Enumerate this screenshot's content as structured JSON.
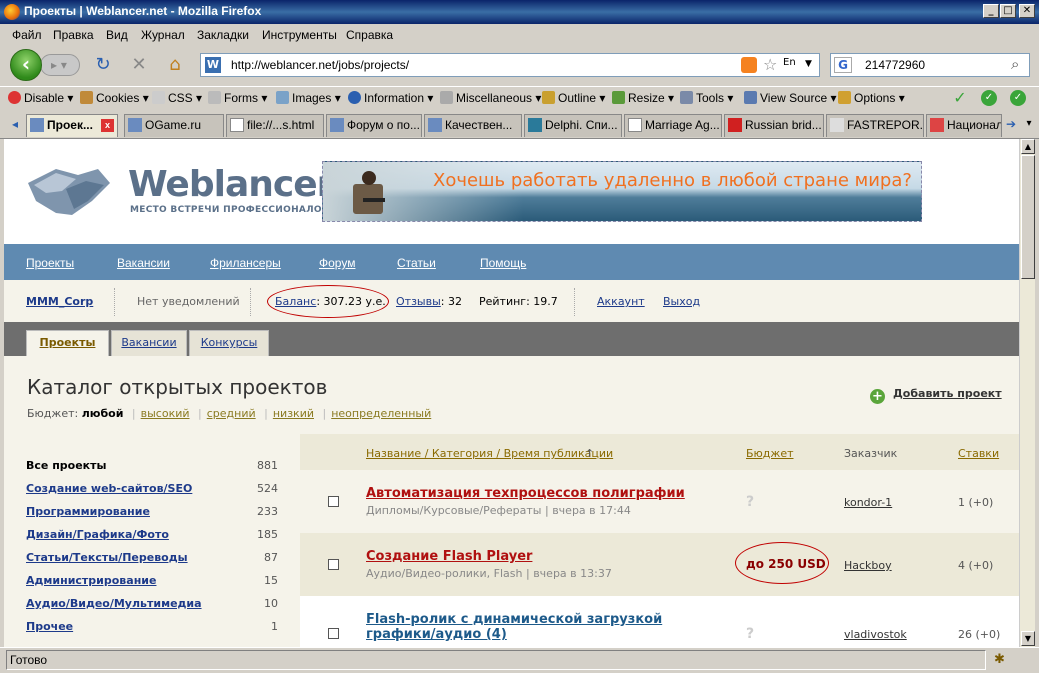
{
  "window": {
    "title": "Проекты | Weblancer.net - Mozilla Firefox",
    "buttons": [
      "_",
      "□",
      "✕"
    ]
  },
  "menu": [
    "Файл",
    "Правка",
    "Вид",
    "Журнал",
    "Закладки",
    "Инструменты",
    "Справка"
  ],
  "nav": {
    "url": "http://weblancer.net/jobs/projects/",
    "search_value": "214772960",
    "favicon_letter": "W",
    "search_engine_letter": "G",
    "lang_label": "En"
  },
  "devtoolbar": [
    "Disable",
    "Cookies",
    "CSS",
    "Forms",
    "Images",
    "Information",
    "Miscellaneous",
    "Outline",
    "Resize",
    "Tools",
    "View Source",
    "Options"
  ],
  "tabs": [
    {
      "label": "Проек...",
      "active": true
    },
    {
      "label": "OGame.ru"
    },
    {
      "label": "file://...s.html"
    },
    {
      "label": "Форум о по..."
    },
    {
      "label": "Качествен..."
    },
    {
      "label": "Delphi. Спи..."
    },
    {
      "label": "Marriage Ag..."
    },
    {
      "label": "Russian brid..."
    },
    {
      "label": "FASTREPOR..."
    },
    {
      "label": "Национал"
    }
  ],
  "site": {
    "logo": "Weblancer",
    "logo_sub": "МЕСТО ВСТРЕЧИ ПРОФЕССИОНАЛОВ",
    "banner_text": "Хочешь работать удаленно в любой стране мира?",
    "nav": [
      "Проекты",
      "Вакансии",
      "Фрилансеры",
      "Форум",
      "Статьи",
      "Помощь"
    ],
    "user": {
      "name": "MMM_Corp",
      "notifications": "Нет уведомлений",
      "balance_label": "Баланс",
      "balance_value": ": 307.23 у.е.",
      "reviews_label": "Отзывы",
      "reviews_value": ": 32",
      "rating": "Рейтинг: 19.7",
      "account": "Аккаунт",
      "logout": "Выход"
    },
    "section_tabs": [
      "Проекты",
      "Вакансии",
      "Конкурсы"
    ],
    "catalog_title": "Каталог открытых проектов",
    "budget_label": "Бюджет:",
    "budget_current": "любой",
    "budget_options": [
      "высокий",
      "средний",
      "низкий",
      "неопределенный"
    ],
    "add_project": "Добавить проект",
    "categories": [
      {
        "label": "Все проекты",
        "count": "881"
      },
      {
        "label": "Создание web-сайтов/SEO",
        "count": "524"
      },
      {
        "label": "Программирование",
        "count": "233"
      },
      {
        "label": "Дизайн/Графика/Фото",
        "count": "185"
      },
      {
        "label": "Статьи/Тексты/Переводы",
        "count": "87"
      },
      {
        "label": "Администрирование",
        "count": "15"
      },
      {
        "label": "Аудио/Видео/Мультимедиа",
        "count": "10"
      },
      {
        "label": "Прочее",
        "count": "1"
      }
    ],
    "list_headers": {
      "name": "Название / Категория / Время публикации",
      "sort_arrow": "↑",
      "budget": "Бюджет",
      "customer": "Заказчик",
      "bids": "Ставки"
    },
    "projects": [
      {
        "title": "Автоматизация техпроцессов полиграфии",
        "meta": "Дипломы/Курсовые/Рефераты | вчера в 17:44",
        "budget": "?",
        "customer": "kondor-1",
        "bids": "1 (+0)",
        "title_color": "#b01010"
      },
      {
        "title": "Создание Flash Player",
        "meta": "Аудио/Видео-ролики, Flash | вчера в 13:37",
        "budget": "до 250 USD",
        "customer": "Hackboy",
        "bids": "4 (+0)",
        "title_color": "#b01010"
      },
      {
        "title_line1": "Flash-ролик с динамической загрузкой",
        "title_line2": "графики/аудио (4)",
        "budget": "?",
        "customer": "vladivostok",
        "bids": "26 (+0)",
        "title_color": "#1d5a8a"
      }
    ]
  },
  "status": "Готово",
  "colors": {
    "nav_band": "#5f8ab1",
    "accent_red": "#b01010",
    "link_blue": "#1d3a8a"
  }
}
